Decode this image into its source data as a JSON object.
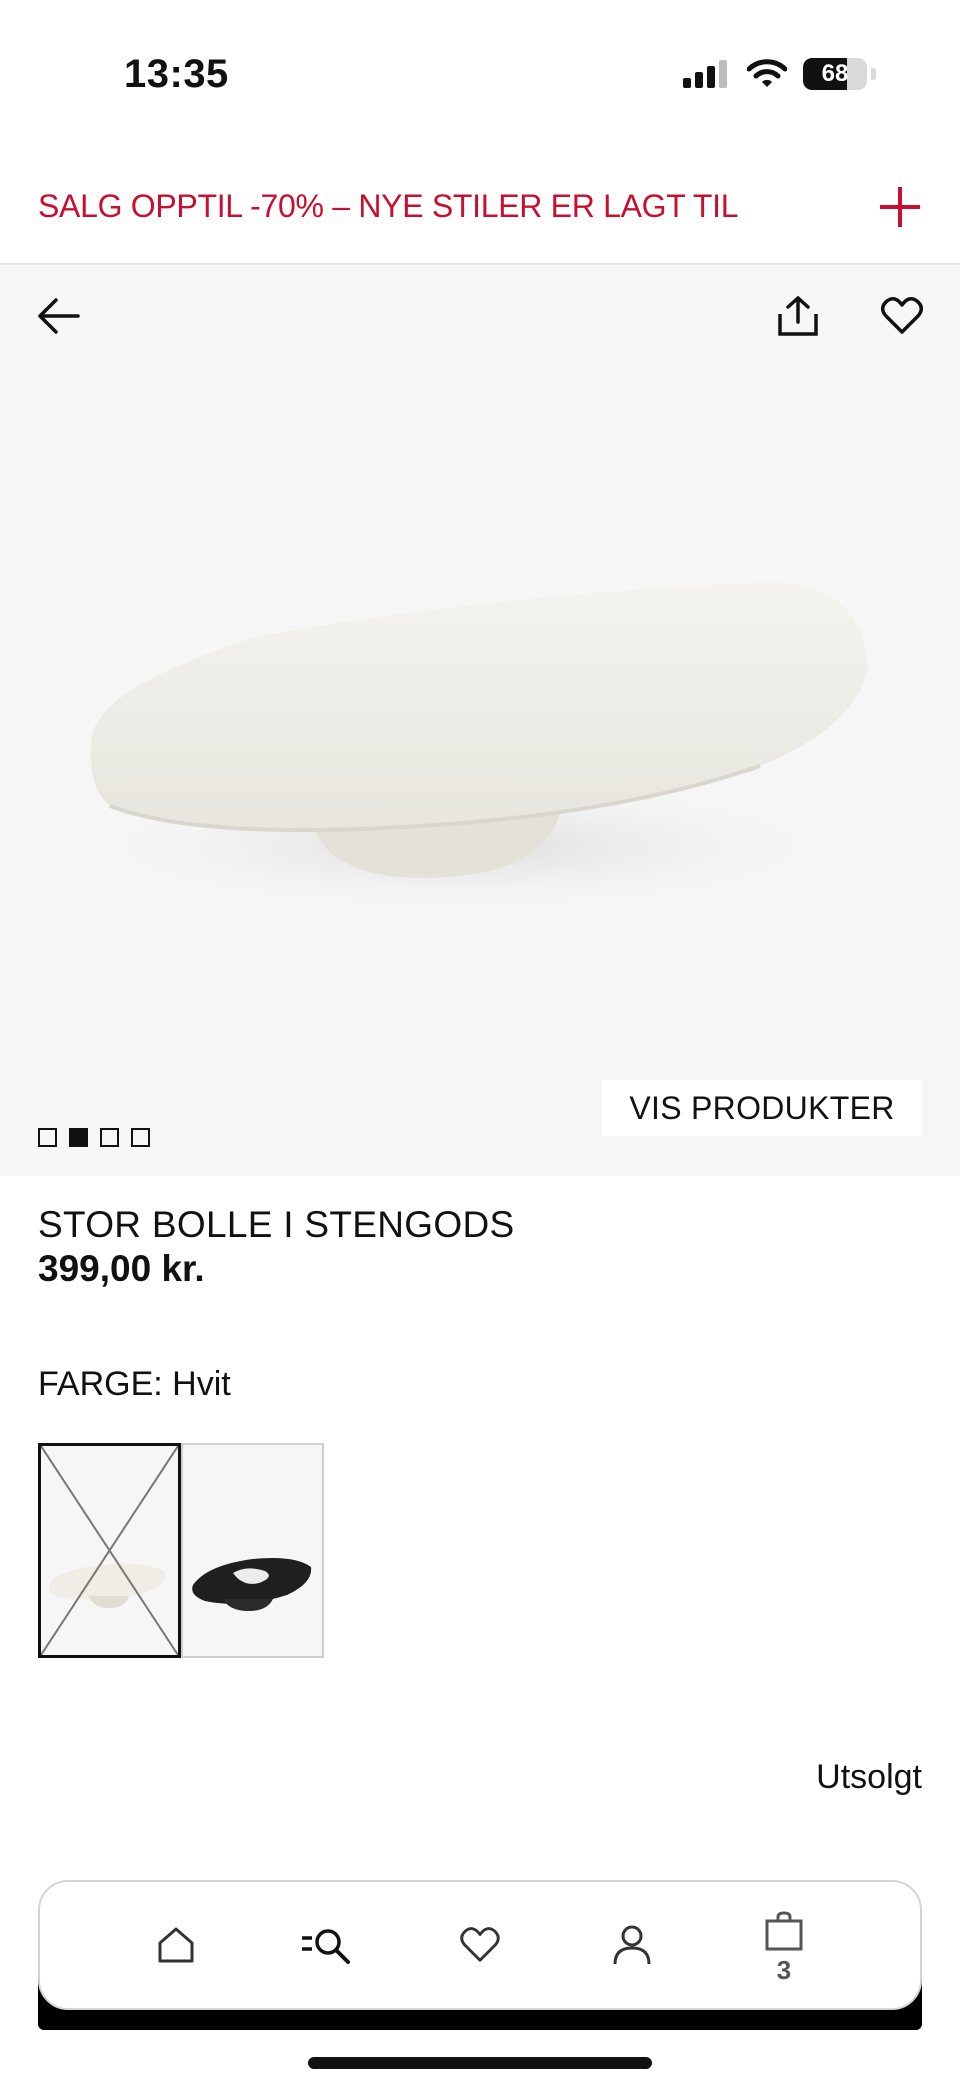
{
  "status_bar": {
    "time": "13:35",
    "battery_level": "68",
    "battery_fraction": 0.68,
    "icons": [
      "cellular-signal-icon",
      "wifi-icon",
      "battery-icon"
    ]
  },
  "promo": {
    "text": "SALG OPPTIL -70% – NYE STILER ER LAGT TIL",
    "icon": "plus-icon",
    "color": "#c8102e"
  },
  "hero": {
    "icons": [
      "back-arrow-icon",
      "share-icon",
      "heart-icon"
    ],
    "show_products_label": "VIS PRODUKTER",
    "image_count": 4,
    "active_image_index": 1
  },
  "product": {
    "title": "STOR BOLLE I STENGODS",
    "price": "399,00 kr.",
    "color_label": "FARGE: Hvit",
    "color_options": [
      "Hvit",
      "Svart"
    ],
    "availability": "Utsolgt"
  },
  "bottom_nav": {
    "items": [
      "home-icon",
      "search-menu-icon",
      "heart-icon",
      "account-icon",
      "shopping-bag-icon"
    ],
    "cart_count": "3"
  }
}
